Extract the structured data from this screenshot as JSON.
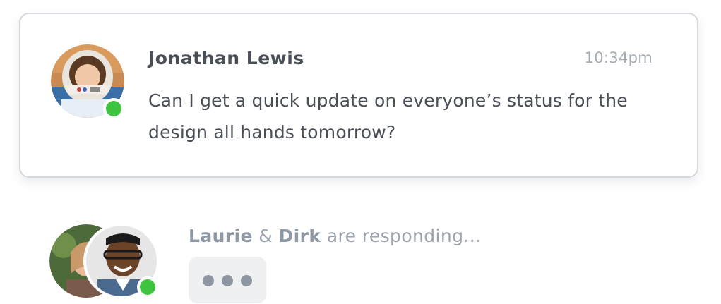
{
  "message": {
    "author": "Jonathan Lewis",
    "time": "10:34pm",
    "text": "Can I get a quick update on everyone’s status for the design all hands tomorrow?",
    "author_online": true
  },
  "typing": {
    "first_name": "Laurie",
    "joiner": "&",
    "second_name": "Dirk",
    "suffix": "are responding..."
  },
  "colors": {
    "online": "#3fc43f",
    "card_border": "#d5d9de",
    "text_primary": "#4a4f57",
    "text_muted": "#9aa3ae",
    "bubble_bg": "#eff0f2"
  },
  "icons": {
    "typing_indicator": "ellipsis-dots",
    "presence": "online-status-dot"
  }
}
